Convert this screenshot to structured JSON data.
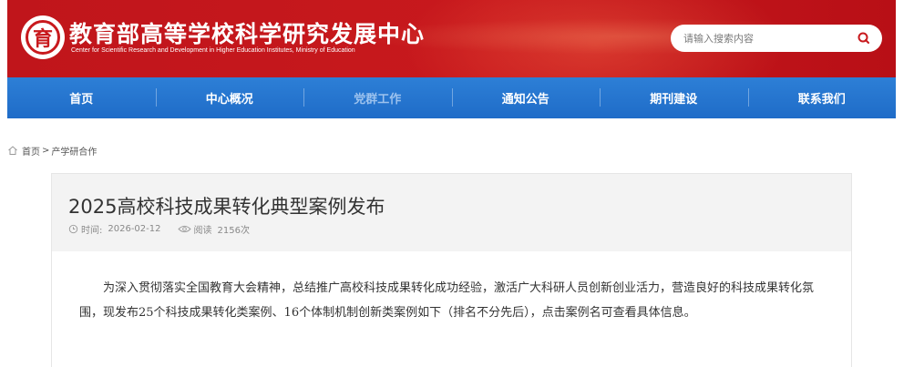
{
  "header": {
    "logo_text": "育",
    "title": "教育部高等学校科学研究发展中心",
    "subtitle": "Center for Scientific Research and Development in Higher Education Institutes, Ministry of Education",
    "search_placeholder": "请输入搜索内容",
    "brand_color": "#c8191d"
  },
  "nav": {
    "items": [
      "首页",
      "中心概况",
      "党群工作",
      "通知公告",
      "期刊建设",
      "联系我们"
    ],
    "color": "#2575cf"
  },
  "breadcrumb": {
    "home": "首页",
    "separator": ">",
    "current": "产学研合作"
  },
  "article": {
    "title": "2025高校科技成果转化典型案例发布",
    "time_label": "时间:",
    "date": "2026-02-12",
    "views_label": "阅读",
    "views": "2156次",
    "paragraph": "为深入贯彻落实全国教育大会精神，总结推广高校科技成果转化成功经验，激活广大科研人员创新创业活力，营造良好的科技成果转化氛围，现发布25个科技成果转化类案例、16个体制机制创新类案例如下（排名不分先后），点击案例名可查看具体信息。"
  }
}
